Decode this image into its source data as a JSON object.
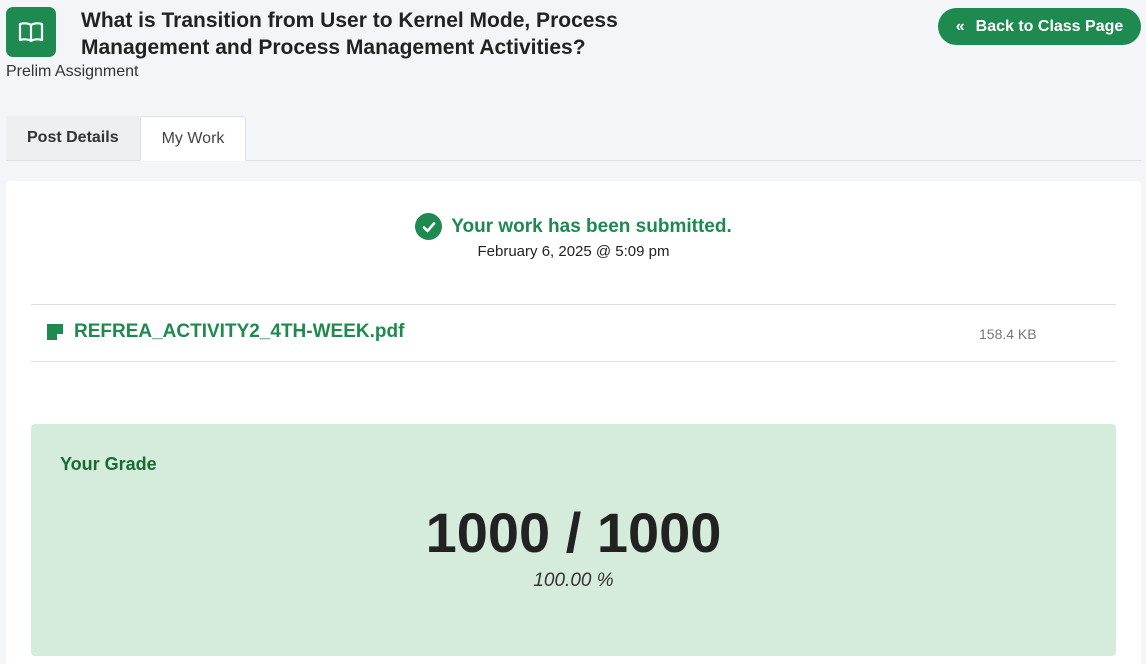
{
  "header": {
    "title": "What is Transition from User to Kernel Mode, Process Management and Process Management Activities?",
    "subtitle": "Prelim Assignment",
    "icon": "book-open-icon",
    "back_label": "Back to Class Page"
  },
  "tabs": [
    {
      "label": "Post Details",
      "active": false
    },
    {
      "label": "My Work",
      "active": true
    }
  ],
  "submission": {
    "status": "Your work has been submitted.",
    "date": "February 6, 2025 @ 5:09 pm"
  },
  "file": {
    "name": "REFREA_ACTIVITY2_4TH-WEEK.pdf",
    "size": "158.4 KB"
  },
  "grade": {
    "label": "Your Grade",
    "score": "1000 / 1000",
    "percent": "100.00 %"
  },
  "colors": {
    "accent": "#1e8a4f",
    "grade_bg": "#d5ecdc",
    "page_bg": "#f4f5f8"
  }
}
